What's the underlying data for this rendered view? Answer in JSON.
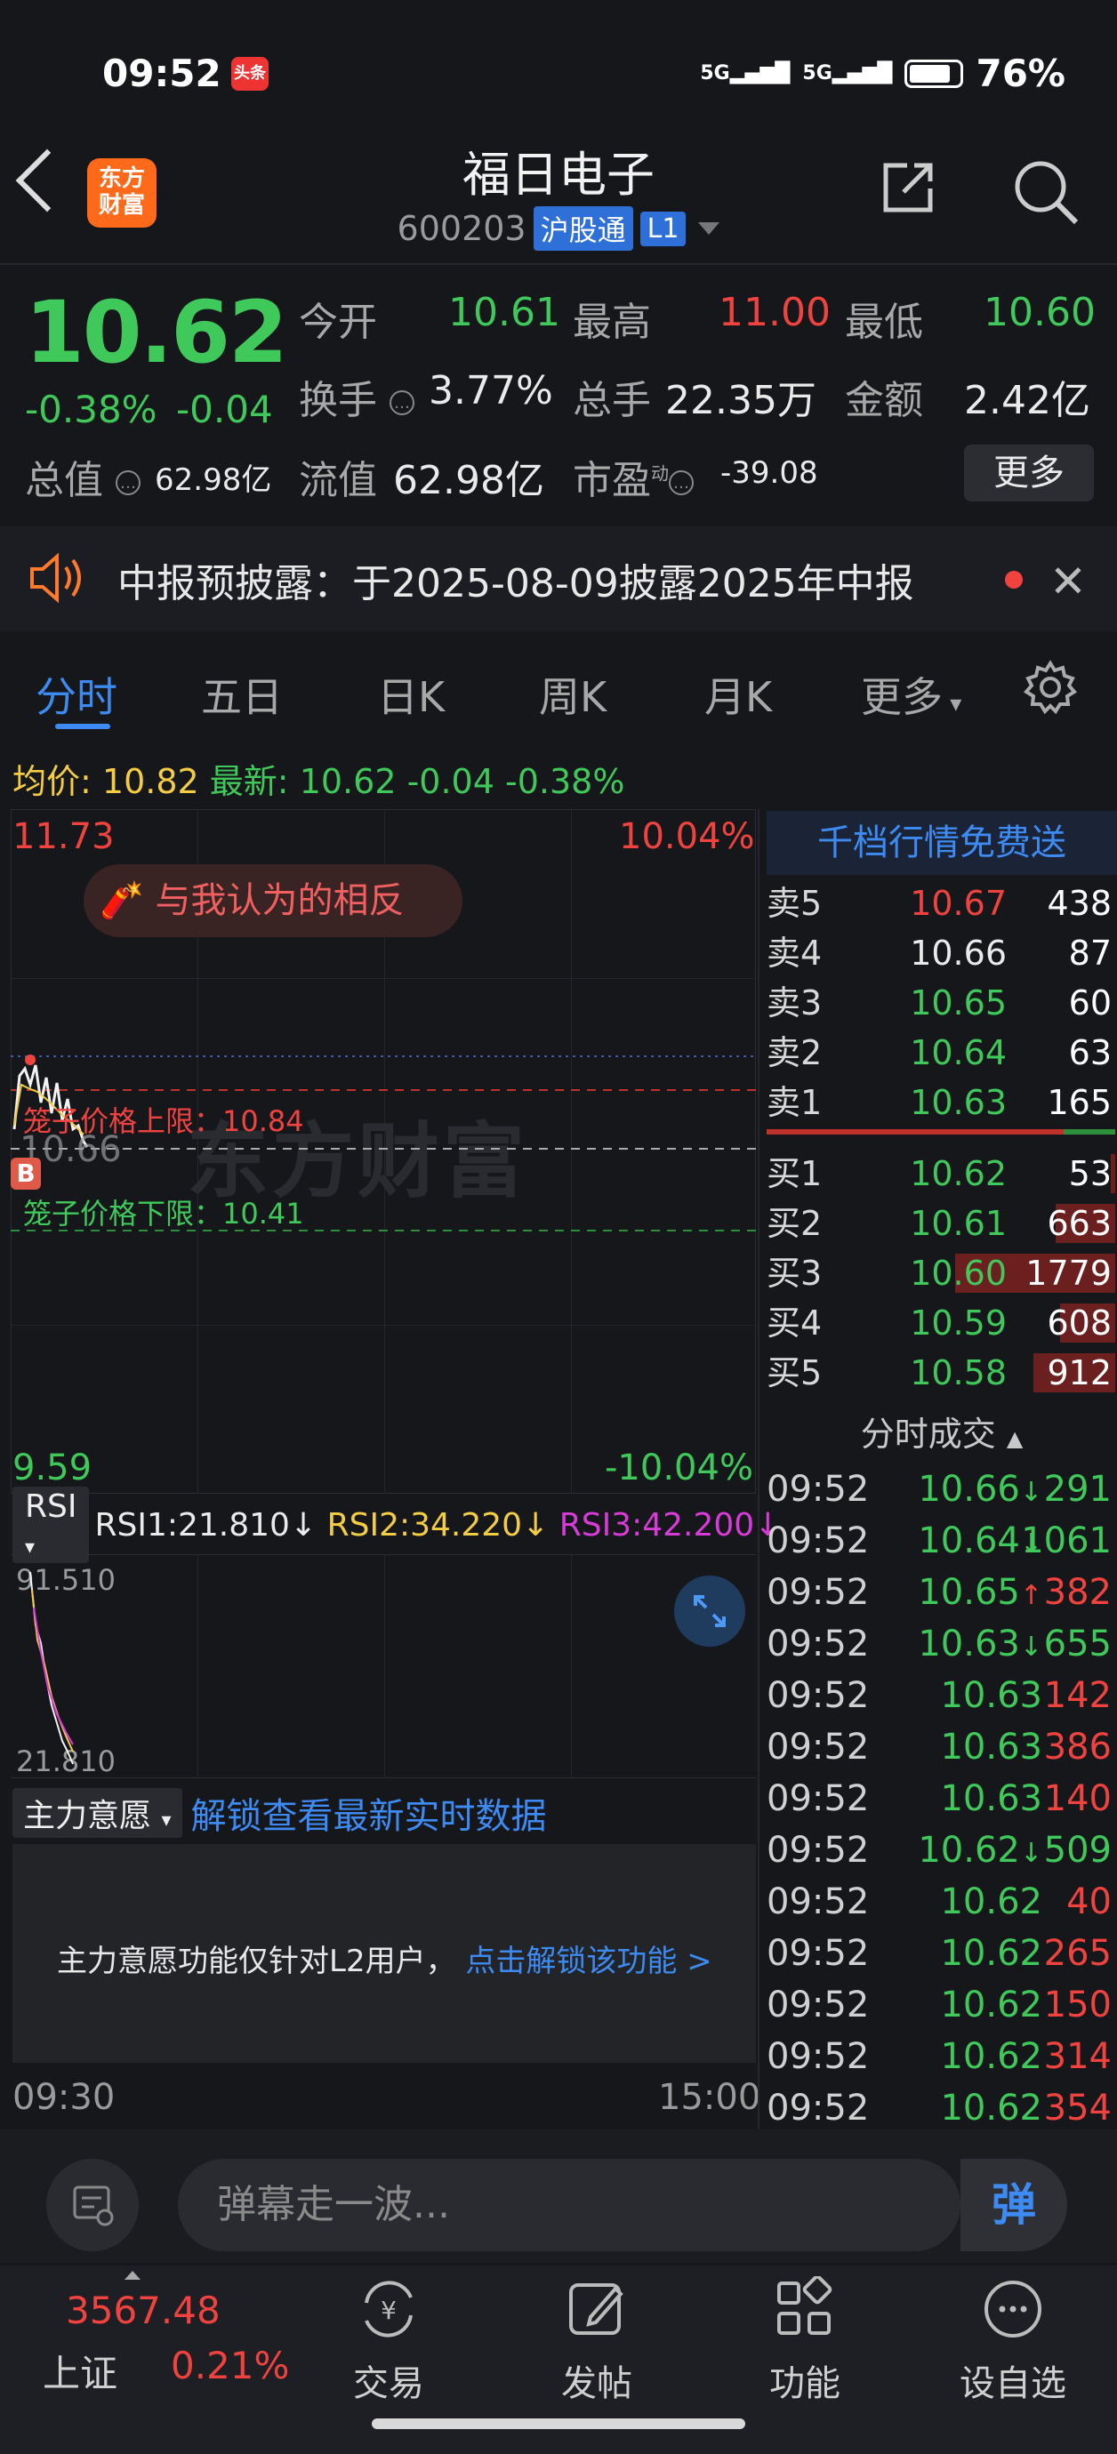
{
  "status_bar": {
    "time": "09:52",
    "app_badge": "头条",
    "signal_1": "5G",
    "signal_2": "5G",
    "battery": "76%"
  },
  "header": {
    "logo_line1": "东方",
    "logo_line2": "财富",
    "stock_name": "福日电子",
    "stock_code": "600203",
    "badge_hgt": "沪股通",
    "badge_level": "L1"
  },
  "quote": {
    "price": "10.62",
    "change_pct": "-0.38%",
    "change": "-0.04",
    "open_label": "今开",
    "open": "10.61",
    "high_label": "最高",
    "high": "11.00",
    "low_label": "最低",
    "low": "10.60",
    "turnover_label": "换手",
    "turnover": "3.77%",
    "volume_label": "总手",
    "volume": "22.35万",
    "amount_label": "金额",
    "amount": "2.42亿",
    "mktcap_label": "总值",
    "mktcap": "62.98亿",
    "float_label": "流值",
    "float": "62.98亿",
    "pe_label": "市盈",
    "pe_super": "动",
    "pe": "-39.08",
    "more": "更多"
  },
  "announcement": {
    "text": "中报预披露：于2025-08-09披露2025年中报"
  },
  "tabs": [
    "分时",
    "五日",
    "日K",
    "周K",
    "月K",
    "更多"
  ],
  "avg_line": {
    "avg_label": "均价:",
    "avg": "10.82",
    "latest_label": "最新:",
    "latest": "10.62",
    "chg": "-0.04",
    "pct": "-0.38%"
  },
  "chart": {
    "top_price": "11.73",
    "top_pct": "10.04%",
    "bottom_price": "9.59",
    "bottom_pct": "-10.04%",
    "mid_price": "10.66",
    "bubble": "与我认为的相反",
    "watermark": "东方财富",
    "cage_upper": "笼子价格上限：10.84",
    "cage_lower": "笼子价格下限：10.41",
    "b_marker": "B",
    "time_start": "09:30",
    "time_end": "15:00"
  },
  "rsi": {
    "select": "RSI",
    "rsi1": "RSI1:21.810",
    "rsi2": "RSI2:34.220",
    "rsi3": "RSI3:42.200",
    "arrow": "↓",
    "top": "91.510",
    "bottom": "21.810"
  },
  "main_intent": {
    "select": "主力意愿",
    "link": "解锁查看最新实时数据",
    "notice": "主力意愿功能仅针对L2用户，",
    "notice_link": "点击解锁该功能 >"
  },
  "orderbook": {
    "header": "千档行情免费送",
    "asks": [
      {
        "label": "卖5",
        "price": "10.67",
        "vol": "438",
        "color": "#f0433f"
      },
      {
        "label": "卖4",
        "price": "10.66",
        "vol": "87",
        "color": "#eaeaea"
      },
      {
        "label": "卖3",
        "price": "10.65",
        "vol": "60",
        "color": "#3fc95a"
      },
      {
        "label": "卖2",
        "price": "10.64",
        "vol": "63",
        "color": "#3fc95a"
      },
      {
        "label": "卖1",
        "price": "10.63",
        "vol": "165",
        "color": "#3fc95a"
      }
    ],
    "bids": [
      {
        "label": "买1",
        "price": "10.62",
        "vol": "53",
        "color": "#3fc95a"
      },
      {
        "label": "买2",
        "price": "10.61",
        "vol": "663",
        "color": "#3fc95a"
      },
      {
        "label": "买3",
        "price": "10.60",
        "vol": "1779",
        "color": "#3fc95a"
      },
      {
        "label": "买4",
        "price": "10.59",
        "vol": "608",
        "color": "#3fc95a"
      },
      {
        "label": "买5",
        "price": "10.58",
        "vol": "912",
        "color": "#3fc95a"
      }
    ]
  },
  "ticks": {
    "title": "分时成交",
    "rows": [
      {
        "time": "09:52",
        "price": "10.66",
        "dir": "↓",
        "vol": "291",
        "vol_color": "#3fc95a"
      },
      {
        "time": "09:52",
        "price": "10.64",
        "dir": "↓",
        "vol": "1061",
        "vol_color": "#3fc95a"
      },
      {
        "time": "09:52",
        "price": "10.65",
        "dir": "↑",
        "vol": "382",
        "vol_color": "#f0433f"
      },
      {
        "time": "09:52",
        "price": "10.63",
        "dir": "↓",
        "vol": "655",
        "vol_color": "#3fc95a"
      },
      {
        "time": "09:52",
        "price": "10.63",
        "dir": "",
        "vol": "142",
        "vol_color": "#f0433f"
      },
      {
        "time": "09:52",
        "price": "10.63",
        "dir": "",
        "vol": "386",
        "vol_color": "#f0433f"
      },
      {
        "time": "09:52",
        "price": "10.63",
        "dir": "",
        "vol": "140",
        "vol_color": "#f0433f"
      },
      {
        "time": "09:52",
        "price": "10.62",
        "dir": "↓",
        "vol": "509",
        "vol_color": "#3fc95a"
      },
      {
        "time": "09:52",
        "price": "10.62",
        "dir": "",
        "vol": "40",
        "vol_color": "#f0433f"
      },
      {
        "time": "09:52",
        "price": "10.62",
        "dir": "",
        "vol": "265",
        "vol_color": "#f0433f"
      },
      {
        "time": "09:52",
        "price": "10.62",
        "dir": "",
        "vol": "150",
        "vol_color": "#f0433f"
      },
      {
        "time": "09:52",
        "price": "10.62",
        "dir": "",
        "vol": "314",
        "vol_color": "#f0433f"
      },
      {
        "time": "09:52",
        "price": "10.62",
        "dir": "",
        "vol": "354",
        "vol_color": "#f0433f"
      }
    ]
  },
  "comment": {
    "placeholder": "弹幕走一波...",
    "dan": "弹"
  },
  "bottom_nav": {
    "index_value": "3567.48",
    "index_name": "上证",
    "index_pct": "0.21%",
    "items": [
      "交易",
      "发帖",
      "功能",
      "设自选"
    ]
  }
}
